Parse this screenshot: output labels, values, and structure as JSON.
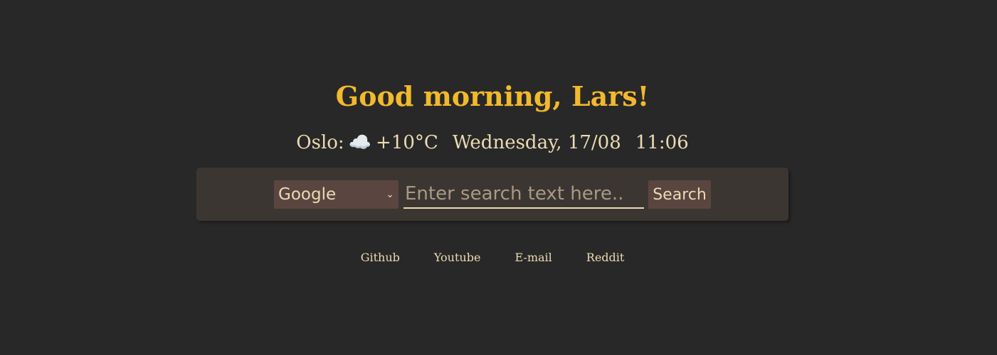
{
  "greeting": "Good morning, Lars!",
  "info": {
    "location_label": "Oslo:",
    "weather_icon": "☁️",
    "temperature": "+10°C",
    "date": "Wednesday, 17/08",
    "time": "11:06"
  },
  "search": {
    "engine_selected": "Google",
    "placeholder": "Enter search text here..",
    "value": "",
    "button_label": "Search"
  },
  "links": [
    {
      "label": "Github"
    },
    {
      "label": "Youtube"
    },
    {
      "label": "E-mail"
    },
    {
      "label": "Reddit"
    }
  ],
  "colors": {
    "background": "#282828",
    "accent": "#f2b92d",
    "text": "#ebdbb2",
    "panel": "#3c3632",
    "control": "#5b4540"
  }
}
